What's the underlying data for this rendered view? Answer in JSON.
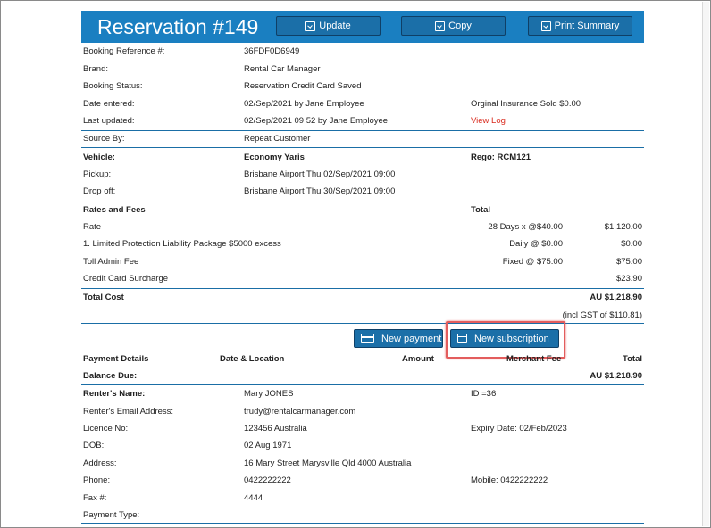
{
  "header": {
    "title": "Reservation #149",
    "update_label": "Update",
    "copy_label": "Copy",
    "print_label": "Print Summary"
  },
  "booking": {
    "ref_label": "Booking Reference #:",
    "ref_value": "36FDF0D6949",
    "brand_label": "Brand:",
    "brand_value": "Rental Car Manager",
    "status_label": "Booking Status:",
    "status_value": "Reservation Credit Card Saved",
    "entered_label": "Date entered:",
    "entered_value": "02/Sep/2021 by Jane Employee",
    "insurance_text": "Orginal Insurance Sold $0.00",
    "updated_label": "Last updated:",
    "updated_value": "02/Sep/2021 09:52 by Jane Employee",
    "view_log": "View Log",
    "source_label": "Source By:",
    "source_value": "Repeat Customer"
  },
  "vehicle": {
    "label": "Vehicle:",
    "value": "Economy Yaris",
    "rego": "Rego: RCM121",
    "pickup_label": "Pickup:",
    "pickup_value": "Brisbane Airport Thu 02/Sep/2021 09:00",
    "dropoff_label": "Drop off:",
    "dropoff_value": "Brisbane Airport Thu 30/Sep/2021 09:00"
  },
  "fees": {
    "header": "Rates and Fees",
    "total_header": "Total",
    "items": [
      {
        "name": "Rate",
        "calc": "28 Days x @$40.00",
        "amount": "$1,120.00"
      },
      {
        "name": "1. Limited Protection Liability Package $5000 excess",
        "calc": "Daily @ $0.00",
        "amount": "$0.00"
      },
      {
        "name": "Toll Admin Fee",
        "calc": "Fixed @ $75.00",
        "amount": "$75.00"
      },
      {
        "name": "Credit Card Surcharge",
        "calc": "",
        "amount": "$23.90"
      }
    ],
    "total_cost_label": "Total Cost",
    "total_cost_value": "AU $1,218.90",
    "gst_text": "(incl GST of $110.81)"
  },
  "payment": {
    "new_payment_label": "New payment",
    "new_subscription_label": "New subscription",
    "col_details": "Payment Details",
    "col_date": "Date & Location",
    "col_amount": "Amount",
    "col_fee": "Merchant Fee",
    "col_total": "Total",
    "balance_label": "Balance Due:",
    "balance_value": "AU $1,218.90"
  },
  "renter": {
    "name_label": "Renter's Name:",
    "name_value": "Mary JONES",
    "id_text": "ID =36",
    "email_label": "Renter's Email Address:",
    "email_value": "trudy@rentalcarmanager.com",
    "licence_label": "Licence No:",
    "licence_value": "123456 Australia",
    "expiry_text": "Expiry Date: 02/Feb/2023",
    "dob_label": "DOB:",
    "dob_value": "02 Aug 1971",
    "address_label": "Address:",
    "address_value": "16 Mary Street Marysville Qld 4000 Australia",
    "phone_label": "Phone:",
    "phone_value": "0422222222",
    "mobile_text": "Mobile: 0422222222",
    "fax_label": "Fax #:",
    "fax_value": "4444",
    "payment_type_label": "Payment Type:"
  },
  "colors": {
    "accent": "#1a7fc1",
    "link": "#d9291c",
    "highlight": "#e35d5d"
  }
}
